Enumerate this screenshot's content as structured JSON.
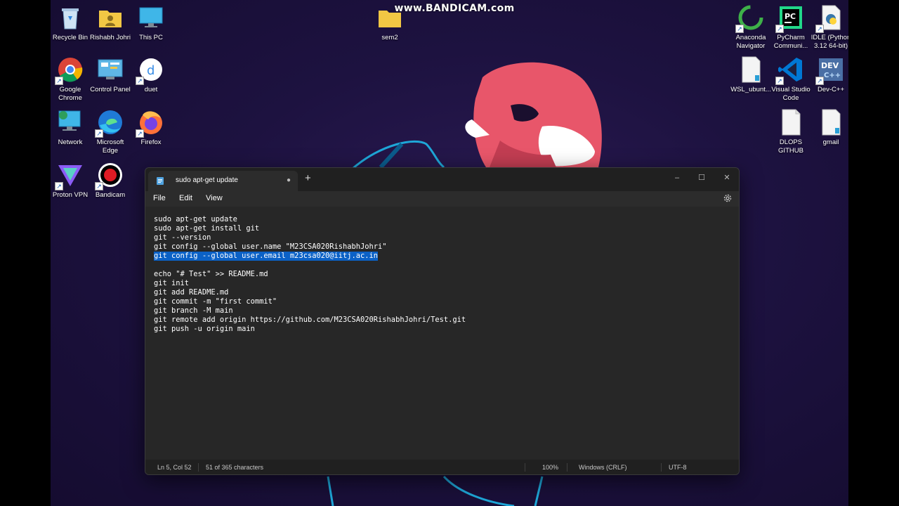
{
  "watermark": "www.BANDICAM.com",
  "desktop_icons": [
    {
      "id": "recycle-bin",
      "label": "Recycle Bin",
      "icon": "recycle-bin-icon",
      "shortcut": false
    },
    {
      "id": "rishabh-johri",
      "label": "Rishabh Johri",
      "icon": "user-folder-icon",
      "shortcut": false
    },
    {
      "id": "this-pc",
      "label": "This PC",
      "icon": "monitor-icon",
      "shortcut": false
    },
    {
      "id": "sem2",
      "label": "sem2",
      "icon": "folder-icon",
      "shortcut": false
    },
    {
      "id": "anaconda",
      "label": "Anaconda Navigator",
      "icon": "anaconda-icon",
      "shortcut": true
    },
    {
      "id": "pycharm",
      "label": "PyCharm Communi...",
      "icon": "pycharm-icon",
      "shortcut": true
    },
    {
      "id": "idle",
      "label": "IDLE (Python 3.12 64-bit)",
      "icon": "python-file-icon",
      "shortcut": true
    },
    {
      "id": "google-chrome",
      "label": "Google Chrome",
      "icon": "chrome-icon",
      "shortcut": true
    },
    {
      "id": "control-panel",
      "label": "Control Panel",
      "icon": "control-panel-icon",
      "shortcut": false
    },
    {
      "id": "duet",
      "label": "duet",
      "icon": "duet-icon",
      "shortcut": true
    },
    {
      "id": "wsl-ubuntu",
      "label": "WSL_ubunt...",
      "icon": "document-icon",
      "shortcut": false
    },
    {
      "id": "vscode",
      "label": "Visual Studio Code",
      "icon": "vscode-icon",
      "shortcut": true
    },
    {
      "id": "devcpp",
      "label": "Dev-C++",
      "icon": "devcpp-icon",
      "shortcut": true
    },
    {
      "id": "network",
      "label": "Network",
      "icon": "network-icon",
      "shortcut": false
    },
    {
      "id": "microsoft-edge",
      "label": "Microsoft Edge",
      "icon": "edge-icon",
      "shortcut": true
    },
    {
      "id": "firefox",
      "label": "Firefox",
      "icon": "firefox-icon",
      "shortcut": true
    },
    {
      "id": "dlops-github",
      "label": "DLOPS GITHUB",
      "icon": "blank-document-icon",
      "shortcut": false
    },
    {
      "id": "gmail",
      "label": "gmail",
      "icon": "document-icon",
      "shortcut": false
    },
    {
      "id": "proton-vpn",
      "label": "Proton VPN",
      "icon": "proton-vpn-icon",
      "shortcut": true
    },
    {
      "id": "bandicam",
      "label": "Bandicam",
      "icon": "bandicam-icon",
      "shortcut": true
    }
  ],
  "notepad": {
    "tab_title": "sudo apt-get update",
    "tab_modified_indicator": "●",
    "new_tab": "+",
    "controls": {
      "minimize": "–",
      "maximize": "☐",
      "close": "✕"
    },
    "menu": {
      "file": "File",
      "edit": "Edit",
      "view": "View"
    },
    "lines": [
      "sudo apt-get update",
      "sudo apt-get install git",
      "git --version",
      "git config --global user.name \"M23CSA020RishabhJohri\"",
      "git config --global user.email m23csa020@iitj.ac.in",
      "",
      "echo \"# Test\" >> README.md",
      "git init",
      "git add README.md",
      "git commit -m \"first commit\"",
      "git branch -M main",
      "git remote add origin https://github.com/M23CSA020RishabhJohri/Test.git",
      "git push -u origin main"
    ],
    "selected_line_index": 4,
    "status": {
      "position": "Ln 5, Col 52",
      "selection": "51 of 365 characters",
      "zoom": "100%",
      "line_ending": "Windows (CRLF)",
      "encoding": "UTF-8"
    }
  },
  "colors": {
    "selection": "#0b61c6",
    "editor_bg": "#272727",
    "desktop_bg": "#1d1240",
    "mask_face": "#e8566a"
  }
}
